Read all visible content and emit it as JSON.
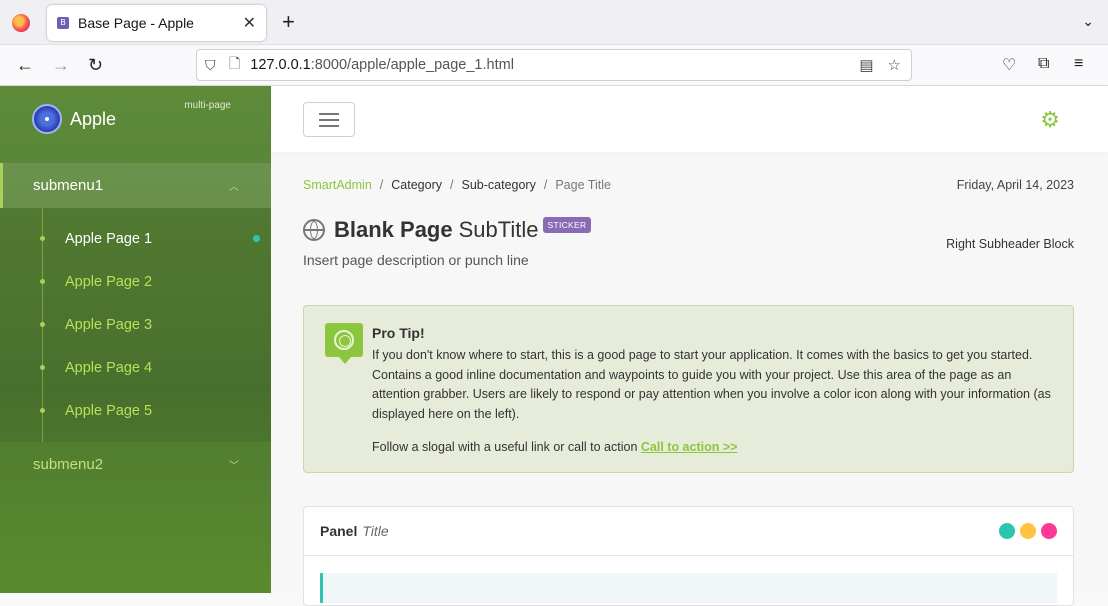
{
  "browser": {
    "tab_title": "Base Page - Apple",
    "url_host": "127.0.0.1",
    "url_rest": ":8000/apple/apple_page_1.html"
  },
  "sidebar": {
    "brand": "Apple",
    "brand_sub": "multi-page",
    "submenu1": {
      "label": "submenu1",
      "items": [
        {
          "label": "Apple Page 1"
        },
        {
          "label": "Apple Page 2"
        },
        {
          "label": "Apple Page 3"
        },
        {
          "label": "Apple Page 4"
        },
        {
          "label": "Apple Page 5"
        }
      ]
    },
    "submenu2": {
      "label": "submenu2"
    }
  },
  "breadcrumb": {
    "root": "SmartAdmin",
    "category": "Category",
    "subcategory": "Sub-category",
    "current": "Page Title"
  },
  "date": "Friday, April 14, 2023",
  "page": {
    "title": "Blank Page",
    "subtitle": "SubTitle",
    "sticker": "STICKER",
    "description": "Insert page description or punch line",
    "right_subheader": "Right Subheader Block"
  },
  "protip": {
    "title": "Pro Tip!",
    "body": "If you don't know where to start, this is a good page to start your application. It comes with the basics to get you started. Contains a good inline documentation and waypoints to guide you with your project. Use this area of the page as an attention grabber. Users are likely to respond or pay attention when you involve a color icon along with your information (as displayed here on the left).",
    "cta_text": "Follow a slogal with a useful link or call to action",
    "cta_link": "Call to action >>"
  },
  "panel": {
    "title": "Panel",
    "subtitle": "Title"
  },
  "colors": {
    "accent": "#8cc63f",
    "sticker": "#886ab5",
    "dot1": "#2cc6b0",
    "dot2": "#ffc241",
    "dot3": "#fd3995"
  }
}
